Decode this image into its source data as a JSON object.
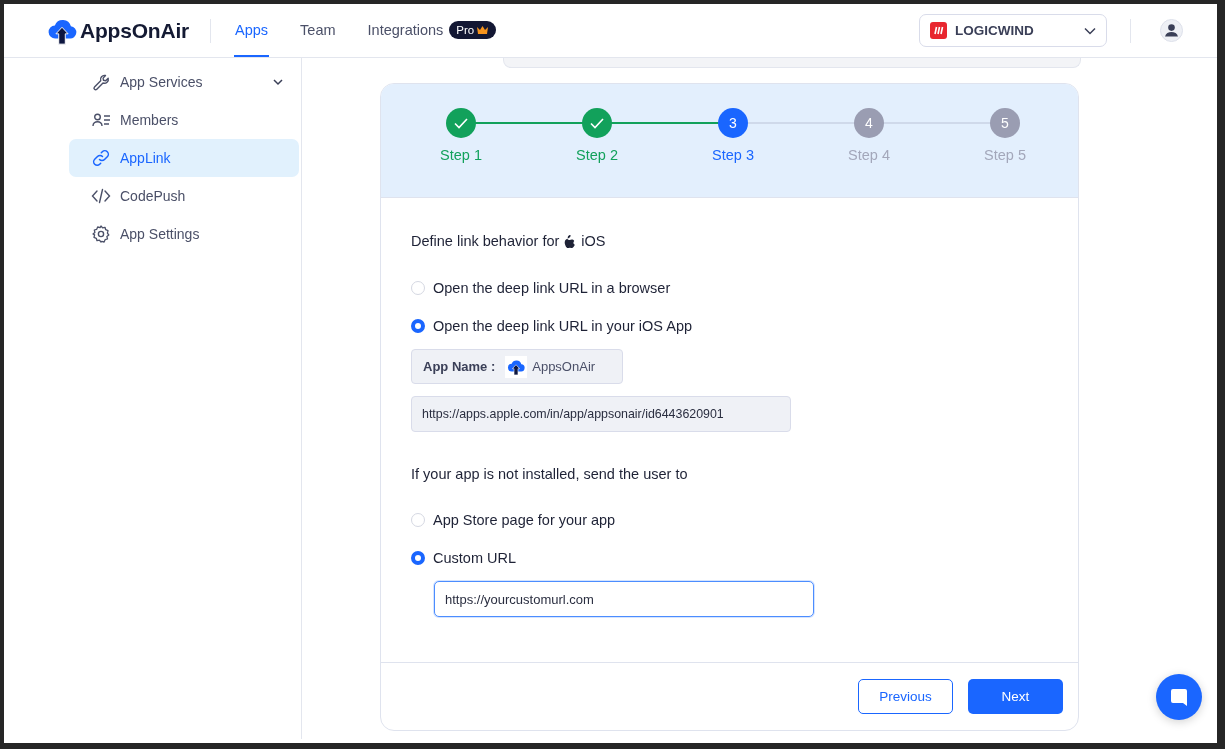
{
  "header": {
    "logo": "AppsOnAir",
    "tabs": [
      {
        "label": "Apps",
        "selected": true
      },
      {
        "label": "Team",
        "selected": false
      },
      {
        "label": "Integrations",
        "selected": false,
        "badge": "Pro"
      }
    ],
    "organization": "LOGICWIND"
  },
  "sidebar": {
    "items": [
      {
        "label": "App Services",
        "kind": "services",
        "selected": false,
        "expandable": true
      },
      {
        "label": "Members",
        "kind": "members",
        "selected": false,
        "expandable": false
      },
      {
        "label": "AppLink",
        "kind": "link",
        "selected": true,
        "expandable": false
      },
      {
        "label": "CodePush",
        "kind": "code",
        "selected": false,
        "expandable": false
      },
      {
        "label": "App Settings",
        "kind": "settings",
        "selected": false,
        "expandable": false
      }
    ]
  },
  "stepper": {
    "steps": [
      {
        "label": "Step 1",
        "completed": true,
        "current": false
      },
      {
        "label": "Step 2",
        "completed": true,
        "current": false
      },
      {
        "label": "Step 3",
        "completed": false,
        "current": true,
        "number": "3"
      },
      {
        "label": "Step 4",
        "completed": false,
        "current": false,
        "number": "4"
      },
      {
        "label": "Step 5",
        "completed": false,
        "current": false,
        "number": "5"
      }
    ]
  },
  "form": {
    "heading": "Define link behavior for",
    "platform": "iOS",
    "options": [
      {
        "label": "Open the deep link URL in a browser",
        "selected": false
      },
      {
        "label": "Open the deep link URL in your iOS App",
        "selected": true
      }
    ],
    "app_name": {
      "label": "App Name :",
      "value": "AppsOnAir"
    },
    "store_url": "https://apps.apple.com/in/app/appsonair/id6443620901",
    "fallback_heading": "If your app is not installed, send the user to",
    "fallback_options": [
      {
        "label": "App Store page for your app",
        "selected": false
      },
      {
        "label": "Custom URL",
        "selected": true
      }
    ],
    "custom_url": "https://yourcustomurl.com"
  },
  "buttons": {
    "previous": "Previous",
    "next": "Next"
  }
}
